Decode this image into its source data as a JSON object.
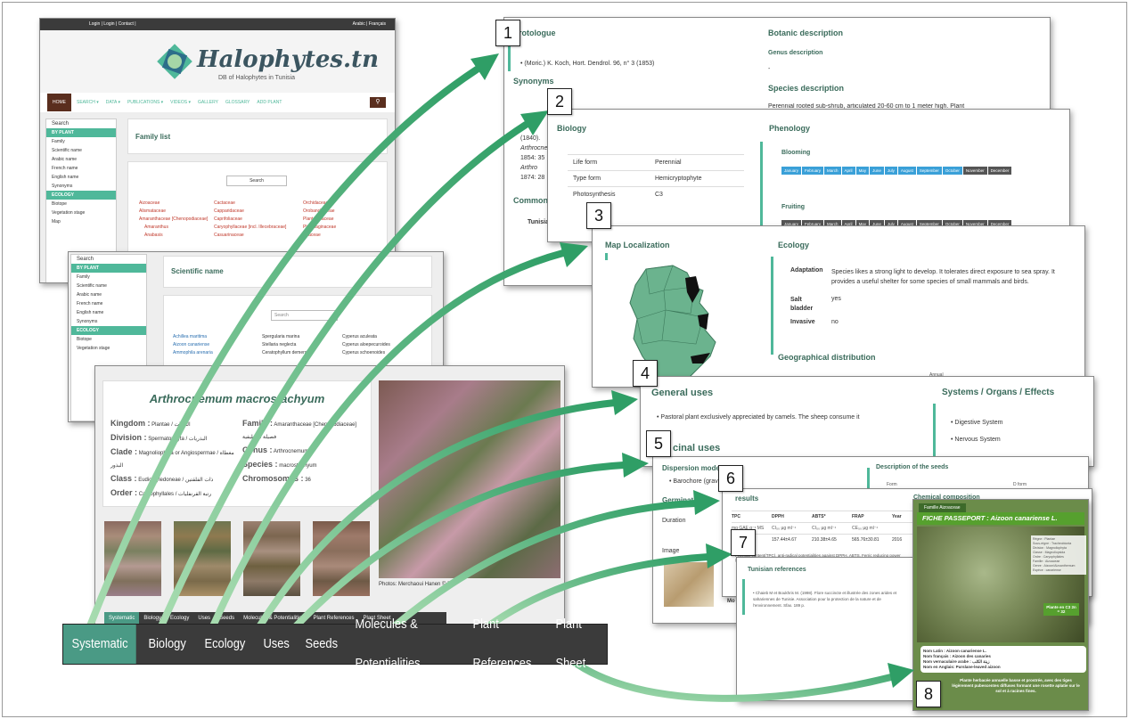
{
  "site": {
    "top_links": "Login | Login | Contact |",
    "lang_links": "Arabic | Français",
    "logo_title": "Halophytes.tn",
    "logo_subtitle": "DB of Halophytes in Tunisia",
    "nav": [
      "HOME",
      "SEARCH ▾",
      "DATA ▾",
      "PUBLICATIONS ▾",
      "VIDEOS ▾",
      "GALLERY",
      "GLOSSARY",
      "ADD PLANT"
    ],
    "sidebar_title": "Search",
    "sidebar_section1": "BY PLANT",
    "sidebar_items": [
      "Family",
      "Scientific name",
      "Arabic name",
      "French name",
      "English name",
      "Synonyms"
    ],
    "sidebar_section2": "ECOLOGY",
    "sidebar_items2": [
      "Biotope",
      "Vegetation stage",
      "Map"
    ],
    "family_list_title": "Family list",
    "search_button": "Search",
    "families": [
      [
        "Aizoaceae",
        "Cactaceae",
        "Orchidaceae"
      ],
      [
        "Alismataceae",
        "Capparidaceae",
        "Orobanchaceae"
      ],
      [
        "Amaranthaceae [Chenopodiaceae]",
        "Caprifoliaceae",
        "Plantaginaceae"
      ],
      [
        "Amaranthus",
        "Caryophyllaceae [incl. Illecebraceae]",
        "Plumbaginaceae"
      ],
      [
        "Anabasis",
        "Casuarinaceae",
        "Poaceae"
      ]
    ]
  },
  "scientific": {
    "title": "Scientific name",
    "search_placeholder": "Search",
    "names": [
      [
        "Achillea maritima",
        "Spergularia marina",
        "Cyperus aculeata"
      ],
      [
        "Aizoon canariense",
        "Stellaria neglecta",
        "Cyperus aloepecuroides"
      ],
      [
        "Ammophila arenaria",
        "Ceratophyllum demersum",
        "Cyperus schoenoides"
      ]
    ]
  },
  "species": {
    "name": "Arthrocnemum macrostachyum",
    "kingdom_label": "Kingdom :",
    "kingdom": "Plantae / النباتات",
    "division_label": "Division :",
    "division": "Spermatophyta / البذريات",
    "clade_label": "Clade :",
    "clade": "Magnoliophyta or Angiospermae / مغطاة البذور",
    "class_label": "Class :",
    "class": "Eudicotyledoneae / ذات الفلقتين",
    "order_label": "Order :",
    "order": "Caryophyllales / رتبة القرنفليات",
    "family_label": "Family :",
    "family": "Amaranthaceae [Chenopodiaceae] فصيلة القطيفية",
    "genus_label": "Genus :",
    "genus": "Arthrocnemum",
    "species_label": "Species :",
    "species_val": "macrostachyum",
    "chromosomes_label": "Chromosomes :",
    "chromosomes": "36",
    "photo_credit": "Photos: Merchaoui Hanen © DR",
    "small_tabs": [
      "Systematic",
      "Biology",
      "Ecology",
      "Uses",
      "Seeds",
      "Molecules & Potentialities",
      "Plant References",
      "Plant Sheet"
    ]
  },
  "tabs": [
    "Systematic",
    "Biology",
    "Ecology",
    "Uses",
    "Seeds",
    "Molecules & Potentialities",
    "Plant References",
    "Plant Sheet"
  ],
  "callouts": [
    "1",
    "2",
    "3",
    "4",
    "5",
    "6",
    "7",
    "8"
  ],
  "panel1": {
    "protologue": "Protologue",
    "protologue_text": "(Moric.) K. Koch, Hort. Dendrol. 96, n° 3 (1853)",
    "synonyms": "Synonyms",
    "syn_lines": [
      "(1840).",
      "Arthrocnemum",
      "1854: 35",
      "Arthro",
      "1874: 28"
    ],
    "common": "Common n",
    "tunisia": "Tunisia",
    "botanic": "Botanic description",
    "genus_desc": "Genus description",
    "genus_desc_text": "-",
    "species_desc": "Species description",
    "species_desc_text": "Perennial rooted sub-shrub, articulated 20-60 cm to 1 meter high. Plant"
  },
  "panel2": {
    "biology": "Biology",
    "rows": [
      [
        "Life form",
        "Perennial"
      ],
      [
        "Type form",
        "Hemicryptophyte"
      ],
      [
        "Photosynthesis",
        "C3"
      ]
    ],
    "phenology": "Phenology",
    "blooming": "Blooming",
    "fruiting": "Fruiting",
    "months": [
      "January",
      "February",
      "March",
      "April",
      "May",
      "June",
      "July",
      "August",
      "September",
      "October",
      "November",
      "December"
    ]
  },
  "panel3": {
    "map": "Map Localization",
    "ecology": "Ecology",
    "adaptation_label": "Adaptation",
    "adaptation": "Species likes a strong light to develop. It tolerates direct exposure to sea spray. It provides a useful shelter for some species of small mammals and birds.",
    "salt_label": "Salt bladder",
    "salt": "yes",
    "invasive_label": "Invasive",
    "invasive": "no",
    "geo": "Geographical distribution",
    "annual": "Annual"
  },
  "panel4": {
    "general": "General uses",
    "general_text": "Pastoral plant exclusively appreciated by camels. The sheep consume it",
    "systems": "Systems / Organs / Effects",
    "systems_items": [
      "Digestive System",
      "Nervous System"
    ],
    "medicinal": "cinal uses"
  },
  "panel5": {
    "dispersion": "Dispersion mode",
    "dispersion_val": "Barochore (gravity)",
    "germination": "Germinat",
    "duration": "Duration",
    "image": "Image",
    "seeds_desc": "Description of the seeds",
    "form": "Form",
    "form_val": "D form"
  },
  "panel6": {
    "results": "results",
    "headers": [
      "TPC",
      "DPPH",
      "ABTS*",
      "FRAP",
      "Year"
    ],
    "units": [
      "mg GAE g⁻¹ MS",
      "CI₅₀ µg ml⁻¹",
      "CI₅₀ µg ml⁻¹",
      "CE₅₀ µg ml⁻¹",
      ""
    ],
    "values": [
      "0.10",
      "157.44±4.67",
      "210.38±4.65",
      "565.76±30.81",
      "2016"
    ],
    "chemical": "Chemical composition",
    "note": "Phenolic content(TPC), anti-radical potentialities against DPPH, ABTS, Ferric reducing power (FRAP)"
  },
  "panel7": {
    "tunisian_refs": "Tunisian references",
    "ref": "Chaieb M et Boukhris M. (1998). Flore succincte et illustrée des zones arides et sahariennes de Tunisie. Association pour la protection de la nature et de l'environnement. Sfax. 189 p.",
    "mo": "Mo"
  },
  "panel8": {
    "family": "Famille Aizoaceae",
    "title": "FICHE PASSEPORT : Aizoon canariense L.",
    "badge": "Plante en C3 2n = 32",
    "side_lines": [
      "Règne : Plantae",
      "Sous-règne : Tracheobionta",
      "Division : Magnoliophyta",
      "Classe : Magnoliopsida",
      "Ordre : Caryophyllales",
      "Famille : Aizoaceae",
      "Genre : Aizoon/Aizoanthemum",
      "Espèce : canariense"
    ],
    "names": [
      "Nom Latin : Aizoon canariense L.",
      "Nom français : Aizoon des canaries",
      "Nom vernaculaire arabe : زيتة الكلب",
      "Nom en Anglais: Purslane-leaved aizoon"
    ],
    "desc": "Plante herbacée annuelle basse et prostrée, avec des tiges légèrement pubescentes diffuses formant une rosette aplatie sur le sol et à racines fines."
  },
  "colors": {
    "accent": "#4fb89a",
    "dark_bar": "#3b3b3b",
    "arrow": "#3daa73"
  }
}
